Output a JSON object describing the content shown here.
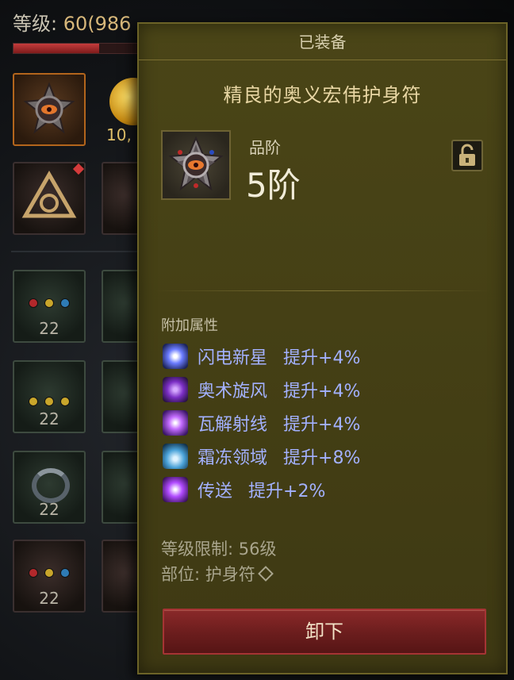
{
  "background": {
    "level_label": "等级: ",
    "level_value": "60(986",
    "gold_partial": "10,",
    "slot_level": "22"
  },
  "tooltip": {
    "header": "已装备",
    "item_name": "精良的奥义宏伟护身符",
    "tier_label": "品阶",
    "tier_value": "5阶",
    "attributes_title": "附加属性",
    "attributes": [
      {
        "skill": "闪电新星",
        "bonus": "提升+4%",
        "icon": "lightning-nova-icon"
      },
      {
        "skill": "奥术旋风",
        "bonus": "提升+4%",
        "icon": "arcane-tornado-icon"
      },
      {
        "skill": "瓦解射线",
        "bonus": "提升+4%",
        "icon": "disintegrate-ray-icon"
      },
      {
        "skill": "霜冻领域",
        "bonus": "提升+8%",
        "icon": "frost-domain-icon"
      },
      {
        "skill": "传送",
        "bonus": "提升+2%",
        "icon": "teleport-icon"
      }
    ],
    "level_requirement": "等级限制: 56级",
    "slot_text": "部位: 护身符",
    "unequip_label": "卸下"
  },
  "colors": {
    "tooltip_bg": "#454015",
    "attribute_text": "#a3b1ff",
    "button_red": "#6b1d1d",
    "gold_text": "#e9d7a4"
  },
  "hp_fill_fraction": 0.64
}
